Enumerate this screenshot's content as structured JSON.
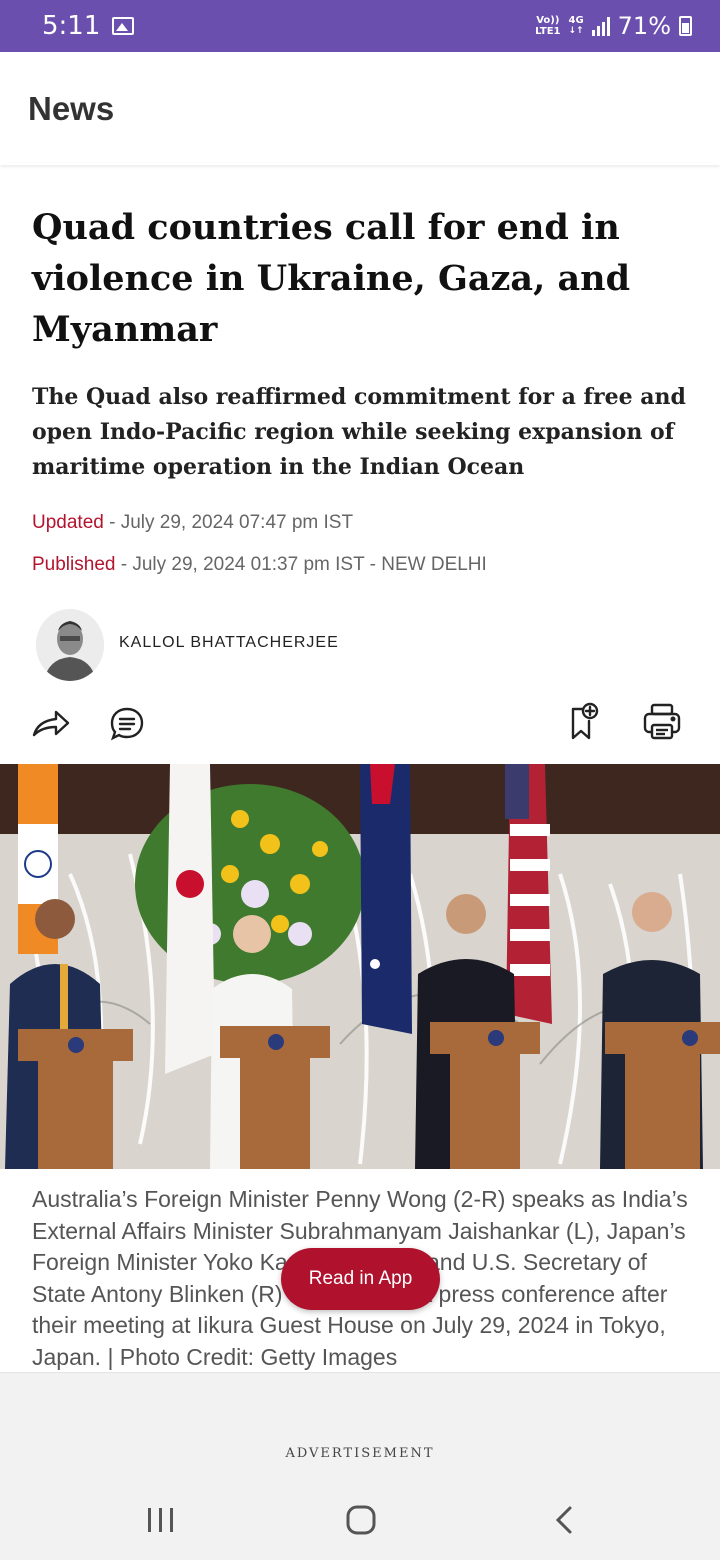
{
  "status_bar": {
    "time": "5:11",
    "network_top": "Vo))",
    "network_bottom": "LTE1",
    "network_type": "4G",
    "battery": "71%",
    "image_icon": "image-icon",
    "signal_icon": "signal-icon",
    "battery_icon": "battery-icon"
  },
  "header": {
    "title": "News"
  },
  "article": {
    "headline": "Quad countries call for end in violence in Ukraine, Gaza, and Myanmar",
    "standfirst": "The Quad also reaffirmed commitment for a free and open Indo-Pacific region while seeking expansion of maritime operation in the Indian Ocean",
    "updated_label": "Updated",
    "updated_value": " - July 29, 2024 07:47 pm IST",
    "published_label": "Published",
    "published_value": " - July 29, 2024 01:37 pm IST - NEW DELHI",
    "author": "KALLOL BHATTACHERJEE",
    "caption": "Australia’s Foreign Minister Penny Wong (2-R) speaks as India’s External Affairs Minister Subrahmanyam Jaishankar (L), Japan’s Foreign Minister Yoko Kamikawa (2-L) and U.S. Secretary of State Antony Blinken (R) listen during a press conference after their meeting at Iikura Guest House on July 29, 2024 in Tokyo, Japan. | Photo Credit: Getty Images"
  },
  "actions": {
    "share_icon": "share-icon",
    "comment_icon": "comment-icon",
    "bookmark_icon": "bookmark-add-icon",
    "print_icon": "print-icon"
  },
  "read_in_app": "Read in App",
  "advertisement_label": "ADVERTISEMENT",
  "colors": {
    "status_bar": "#6b4fae",
    "accent_red": "#b3142f",
    "button_red": "#b0122e"
  }
}
